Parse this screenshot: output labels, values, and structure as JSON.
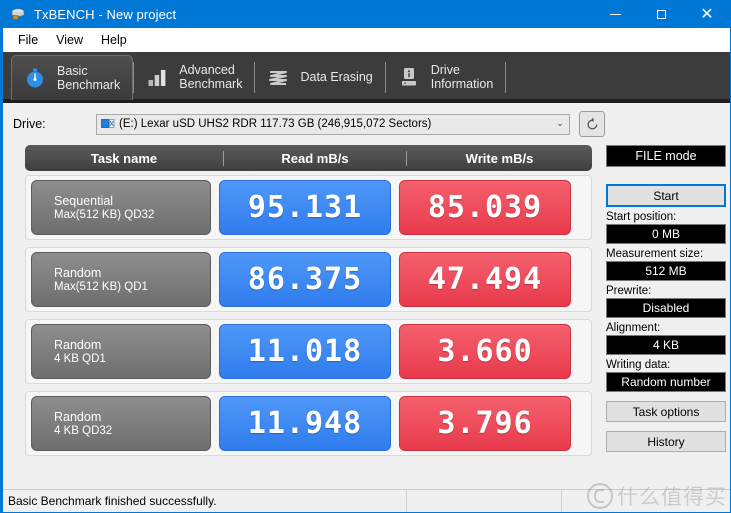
{
  "window": {
    "title": "TxBENCH - New project",
    "icon": "drive-icon",
    "minimize_label": "",
    "maximize_label": "",
    "close_label": "✕",
    "accent_color": "#0078d7"
  },
  "menubar": {
    "items": [
      {
        "label": "File"
      },
      {
        "label": "View"
      },
      {
        "label": "Help"
      }
    ]
  },
  "tabs": [
    {
      "label": "Basic\nBenchmark",
      "icon": "stopwatch-icon",
      "active": true
    },
    {
      "label": "Advanced\nBenchmark",
      "icon": "bar-chart-icon",
      "active": false
    },
    {
      "label": "Data Erasing",
      "icon": "eraser-waves-icon",
      "active": false
    },
    {
      "label": "Drive\nInformation",
      "icon": "drive-info-icon",
      "active": false
    }
  ],
  "drive": {
    "label": "Drive:",
    "selected": "(E:) Lexar uSD UHS2 RDR  117.73 GB (246,915,072 Sectors)",
    "dropdown_arrow": "⌄",
    "refresh_icon": "refresh-icon"
  },
  "results": {
    "columns": [
      "Task name",
      "Read mB/s",
      "Write mB/s"
    ],
    "read_color": "#3c8ef5",
    "write_color": "#ef4b5a",
    "rows": [
      {
        "name": "Sequential",
        "detail": "Max(512 KB) QD32",
        "read": "95.131",
        "write": "85.039"
      },
      {
        "name": "Random",
        "detail": "Max(512 KB) QD1",
        "read": "86.375",
        "write": "47.494"
      },
      {
        "name": "Random",
        "detail": "4 KB QD1",
        "read": "11.018",
        "write": "3.660"
      },
      {
        "name": "Random",
        "detail": "4 KB QD32",
        "read": "11.948",
        "write": "3.796"
      }
    ]
  },
  "chart_data": {
    "type": "bar",
    "title": "Basic Benchmark results",
    "categories": [
      "Sequential Max(512 KB) QD32",
      "Random Max(512 KB) QD1",
      "Random 4 KB QD1",
      "Random 4 KB QD32"
    ],
    "series": [
      {
        "name": "Read mB/s",
        "values": [
          95.131,
          86.375,
          11.018,
          11.948
        ]
      },
      {
        "name": "Write mB/s",
        "values": [
          85.039,
          47.494,
          3.66,
          3.796
        ]
      }
    ],
    "xlabel": "Task name",
    "ylabel": "mB/s",
    "legend": "top"
  },
  "sidebar": {
    "mode_label": "FILE mode",
    "start_label": "Start",
    "fields": [
      {
        "label": "Start position:",
        "value": "0 MB"
      },
      {
        "label": "Measurement size:",
        "value": "512 MB"
      },
      {
        "label": "Prewrite:",
        "value": "Disabled"
      },
      {
        "label": "Alignment:",
        "value": "4 KB"
      },
      {
        "label": "Writing data:",
        "value": "Random number"
      }
    ],
    "task_options_label": "Task options",
    "history_label": "History"
  },
  "statusbar": {
    "message": "Basic Benchmark finished successfully.",
    "segment2": "",
    "segment3": ""
  },
  "watermark": {
    "text": "什么值得买"
  }
}
